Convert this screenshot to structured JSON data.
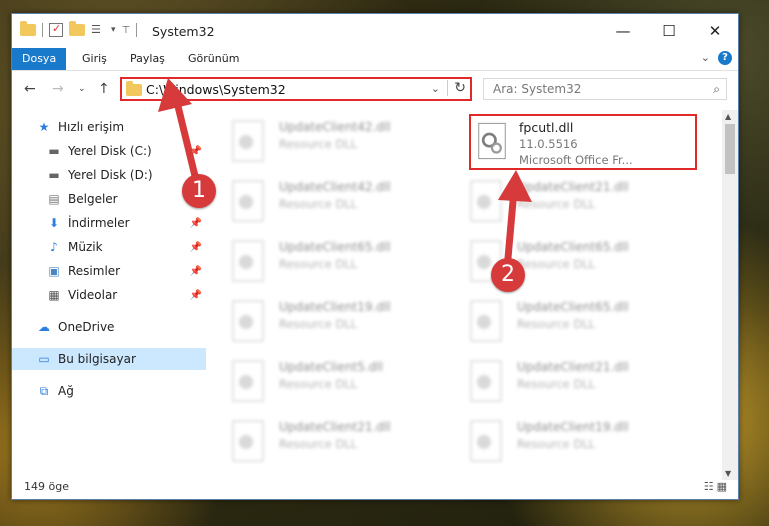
{
  "window": {
    "title": "System32"
  },
  "ribbon": {
    "tabs": [
      "Dosya",
      "Giriş",
      "Paylaş",
      "Görünüm"
    ]
  },
  "address": {
    "path": "C:\\Windows\\System32"
  },
  "search": {
    "placeholder": "Ara: System32"
  },
  "sidebar": {
    "items": [
      {
        "label": "Hızlı erişim",
        "icon": "star-icon"
      },
      {
        "label": "Yerel Disk (C:)",
        "icon": "drive-icon"
      },
      {
        "label": "Yerel Disk (D:)",
        "icon": "drive-icon"
      },
      {
        "label": "Belgeler",
        "icon": "documents-icon"
      },
      {
        "label": "İndirmeler",
        "icon": "download-icon"
      },
      {
        "label": "Müzik",
        "icon": "music-icon"
      },
      {
        "label": "Resimler",
        "icon": "pictures-icon"
      },
      {
        "label": "Videolar",
        "icon": "videos-icon"
      },
      {
        "label": "OneDrive",
        "icon": "cloud-icon"
      },
      {
        "label": "Bu bilgisayar",
        "icon": "computer-icon"
      },
      {
        "label": "Ağ",
        "icon": "network-icon"
      }
    ]
  },
  "highlighted_file": {
    "name": "fpcutl.dll",
    "version": "11.0.5516",
    "description": "Microsoft Office Fr..."
  },
  "files": [
    {
      "name": "UpdateClient42.dll",
      "desc": "Resource DLL"
    },
    {
      "name": "UpdateClient42.dll",
      "desc": "Resource DLL"
    },
    {
      "name": "UpdateClient21.dll",
      "desc": "Resource DLL"
    },
    {
      "name": "UpdateClient65.dll",
      "desc": "Resource DLL"
    },
    {
      "name": "UpdateClient65.dll",
      "desc": "Resource DLL"
    },
    {
      "name": "UpdateClient19.dll",
      "desc": "Resource DLL"
    },
    {
      "name": "UpdateClient65.dll",
      "desc": "Resource DLL"
    },
    {
      "name": "UpdateClient5.dll",
      "desc": "Resource DLL"
    },
    {
      "name": "UpdateClient21.dll",
      "desc": "Resource DLL"
    },
    {
      "name": "UpdateClient21.dll",
      "desc": "Resource DLL"
    },
    {
      "name": "UpdateClient19.dll",
      "desc": "Resource DLL"
    }
  ],
  "status": {
    "count": "149 öge"
  },
  "callouts": [
    "1",
    "2"
  ],
  "colors": {
    "accent": "#1979ca",
    "highlight": "#e02a2a",
    "callout": "#d63a3a"
  }
}
